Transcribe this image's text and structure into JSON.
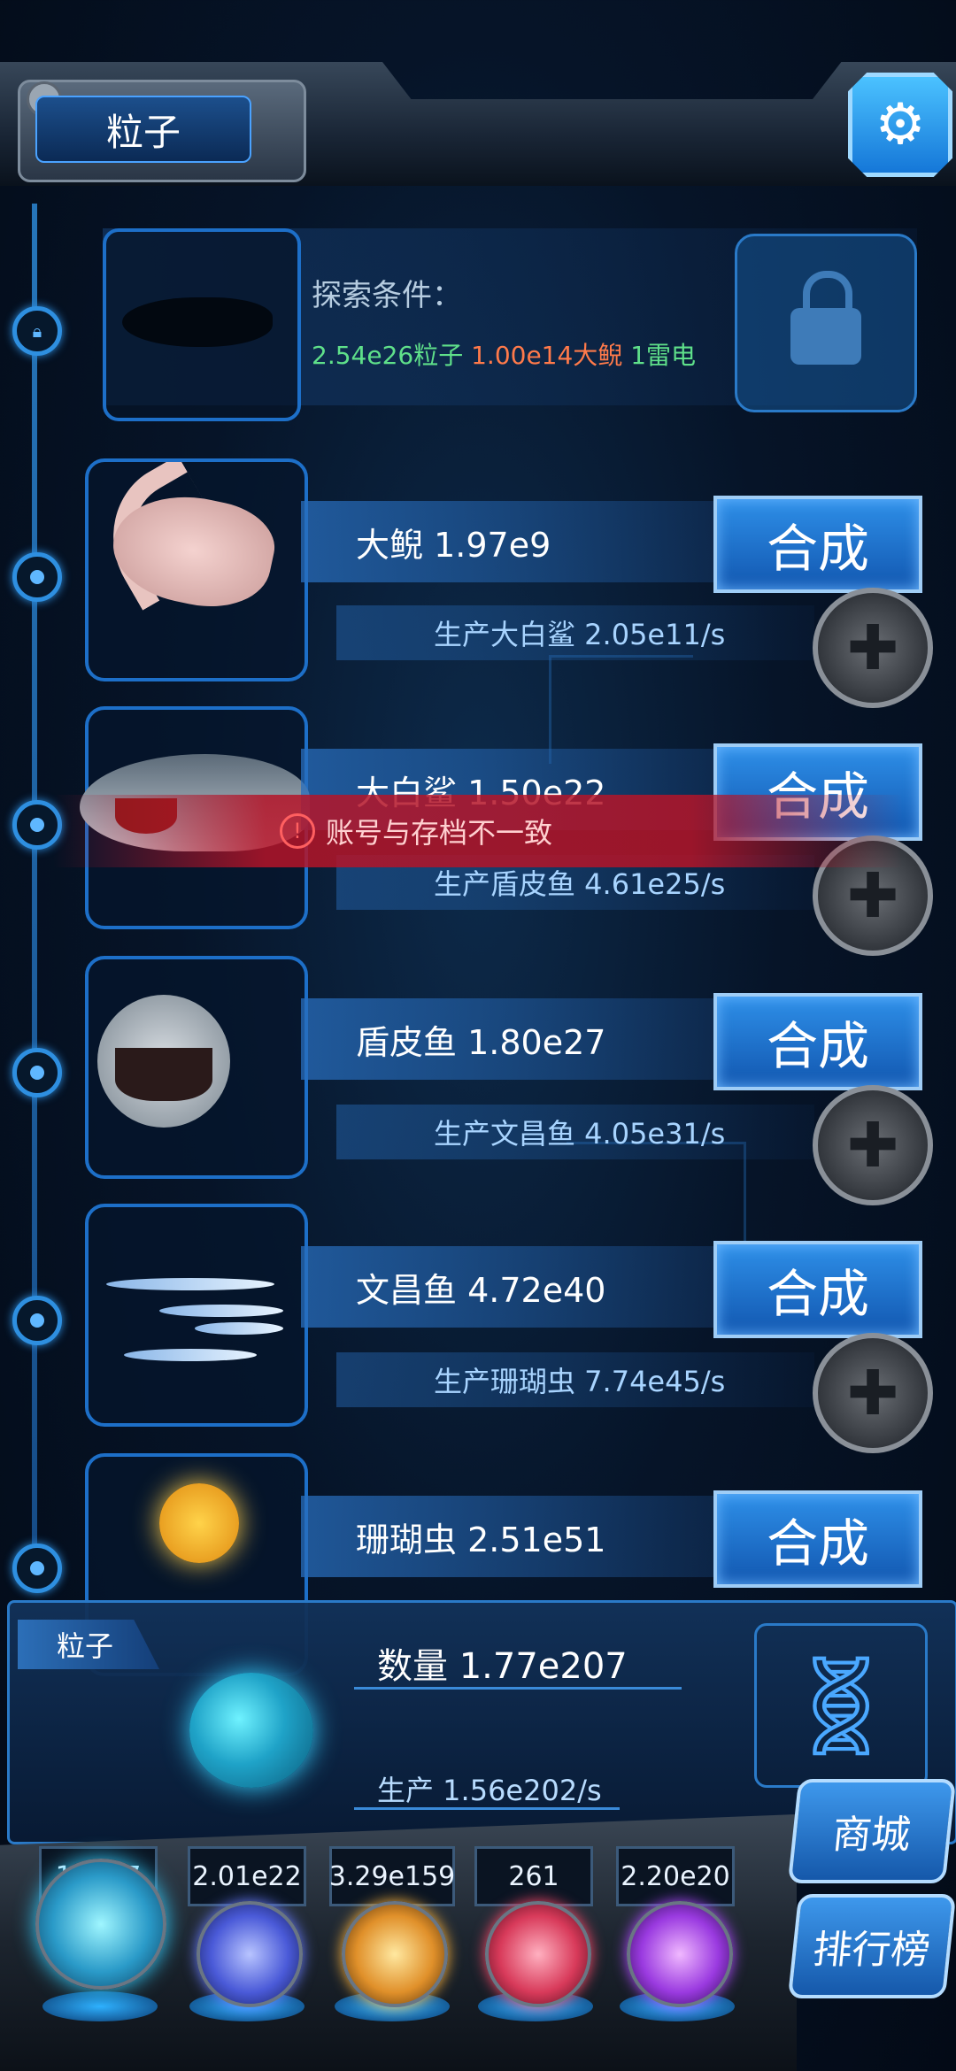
{
  "header": {
    "title": "粒子",
    "settings_icon": "gear-icon"
  },
  "explore": {
    "title": "探索条件：",
    "requirements": [
      {
        "text": "2.54e26粒子",
        "color": "#5fe08a"
      },
      {
        "text": "1.00e14大鲵",
        "color": "#ff7a4a"
      },
      {
        "text": "1雷电",
        "color": "#5fe08a"
      }
    ]
  },
  "creatures": [
    {
      "name_line": "大鲵 1.97e9",
      "produce_line": "生产大白鲨 2.05e11/s",
      "synth_label": "合成"
    },
    {
      "name_line": "大白鲨 1.50e22",
      "produce_line": "生产盾皮鱼 4.61e25/s",
      "synth_label": "合成"
    },
    {
      "name_line": "盾皮鱼 1.80e27",
      "produce_line": "生产文昌鱼 4.05e31/s",
      "synth_label": "合成"
    },
    {
      "name_line": "文昌鱼 4.72e40",
      "produce_line": "生产珊瑚虫 7.74e45/s",
      "synth_label": "合成"
    },
    {
      "name_line": "珊瑚虫 2.51e51",
      "synth_label": "合成"
    }
  ],
  "error": {
    "message": "账号与存档不一致",
    "icon": "exclamation-icon"
  },
  "particle_panel": {
    "tab": "粒子",
    "count": "数量 1.77e207",
    "rate": "生产 1.56e202/s",
    "dna_icon": "dna-icon"
  },
  "resources": [
    {
      "value": "1.__07",
      "icon": "particle-orb-icon",
      "color": "#36d0ff"
    },
    {
      "value": "2.01e22",
      "icon": "lightning-orb-icon",
      "color": "#6a7cff"
    },
    {
      "value": "3.29e159",
      "icon": "galaxy-orb-icon",
      "color": "#ffb43a"
    },
    {
      "value": "261",
      "icon": "brain-orb-icon",
      "color": "#ff4a6a"
    },
    {
      "value": "2.20e20",
      "icon": "vortex-orb-icon",
      "color": "#b04aff"
    }
  ],
  "side_buttons": {
    "shop": "商城",
    "rank": "排行榜"
  }
}
